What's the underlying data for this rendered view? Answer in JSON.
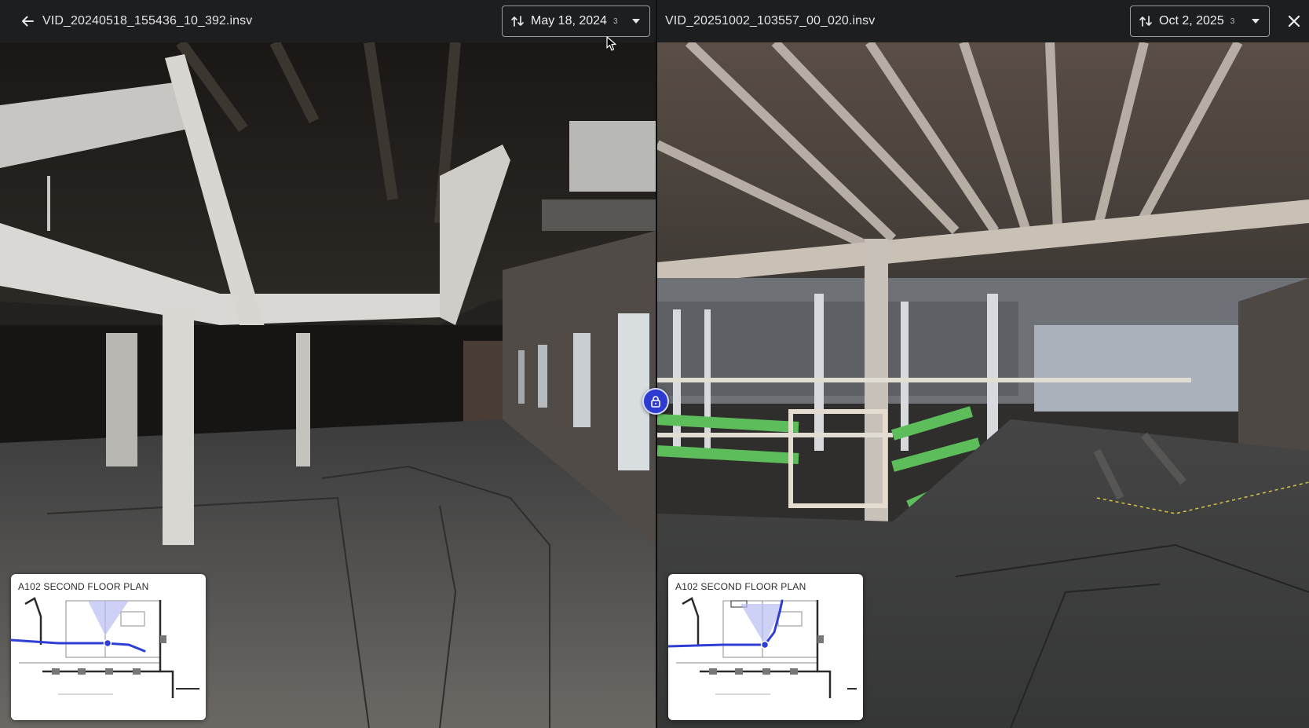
{
  "left": {
    "filename": "VID_20240518_155436_10_392.insv",
    "date": "May 18, 2024",
    "count": "3",
    "minimap_title": "A102 SECOND FLOOR PLAN"
  },
  "right": {
    "filename": "VID_20251002_103557_00_020.insv",
    "date": "Oct 2, 2025",
    "count": "3",
    "minimap_title": "A102 SECOND FLOOR PLAN"
  },
  "icons": {
    "back": "arrow-left-icon",
    "date_picker": "compare-arrows-icon",
    "dropdown": "chevron-down-icon",
    "close": "close-icon",
    "sync_lock": "lock-icon"
  },
  "colors": {
    "accent": "#2e3bd3",
    "path": "#2f3fd6",
    "topbar": "#1d1e20"
  }
}
